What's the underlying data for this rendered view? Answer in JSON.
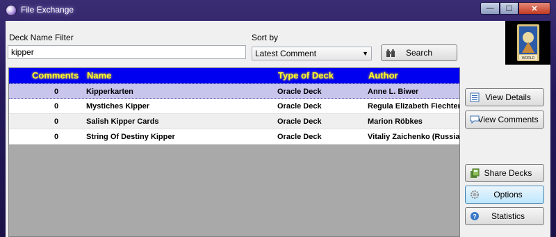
{
  "window": {
    "title": "File Exchange",
    "min_glyph": "—",
    "max_glyph": "☐",
    "close_glyph": "✕"
  },
  "filter": {
    "label": "Deck Name Filter",
    "value": "kipper"
  },
  "sort": {
    "label": "Sort by",
    "selected": "Latest Comment"
  },
  "search_button": {
    "label": "Search"
  },
  "thumbnail": {
    "caption": "WORLD"
  },
  "table": {
    "columns": [
      "Comments",
      "Name",
      "Type of Deck",
      "Author"
    ],
    "rows": [
      {
        "comments": "0",
        "name": "Kipperkarten",
        "type": "Oracle Deck",
        "author": "Anne L. Biwer"
      },
      {
        "comments": "0",
        "name": "Mystiches Kipper",
        "type": "Oracle Deck",
        "author": "Regula Elizabeth Fiechter"
      },
      {
        "comments": "0",
        "name": "Salish Kipper Cards",
        "type": "Oracle Deck",
        "author": "Marion Röbkes"
      },
      {
        "comments": "0",
        "name": "String Of Destiny Kipper",
        "type": "Oracle Deck",
        "author": "Vitaliy Zaichenko (Russia)"
      }
    ],
    "selected_row": 0
  },
  "side_buttons": {
    "view_details": "View Details",
    "view_comments": "View Comments",
    "share_decks": "Share Decks",
    "options": "Options",
    "statistics": "Statistics"
  },
  "colors": {
    "header_bg": "#0000f0",
    "header_text": "#fffd2a",
    "selected_row": "#c8c5ed",
    "frame": "#24185a"
  }
}
